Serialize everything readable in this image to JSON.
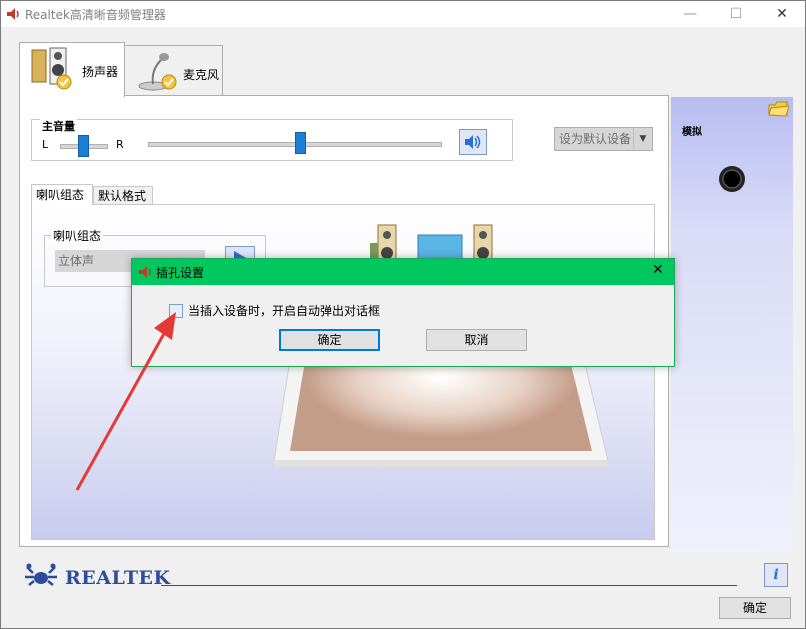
{
  "window": {
    "title": "Realtek高清晰音频管理器"
  },
  "tabs": {
    "speaker": "扬声器",
    "mic": "麦克风"
  },
  "volume": {
    "label": "主音量",
    "left": "L",
    "right": "R",
    "balance": 0.5,
    "level": 0.52
  },
  "default_device_button": "设为默认设备",
  "subtabs": {
    "config": "喇叭组态",
    "format": "默认格式"
  },
  "config_group": {
    "label": "喇叭组态",
    "selected": "立体声"
  },
  "right_panel": {
    "label": "模拟"
  },
  "dialog": {
    "title": "插孔设置",
    "checkbox_label": "当插入设备时，开启自动弹出对话框",
    "ok": "确定",
    "cancel": "取消",
    "checked": false
  },
  "footer": {
    "brand": "REALTEK",
    "ok": "确定"
  },
  "colors": {
    "dialog_title": "#00c85f",
    "slider": "#1c7fd6",
    "arrow": "#e53935"
  }
}
